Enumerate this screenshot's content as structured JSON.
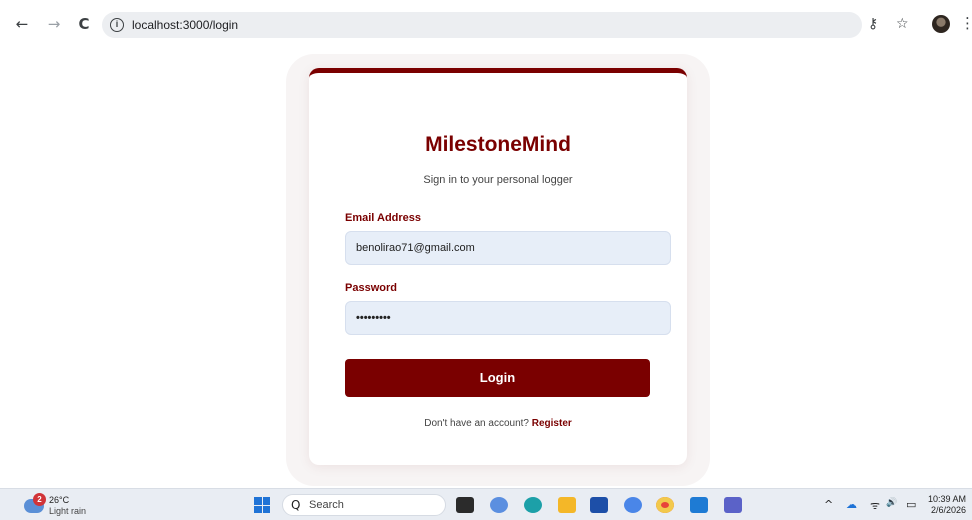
{
  "browser": {
    "url": "localhost:3000/login",
    "back_icon": "←",
    "forward_icon": "→",
    "reload_icon": "C",
    "info_icon": "i",
    "key_icon": "⚷",
    "star_icon": "☆",
    "menu_icon": "⋮"
  },
  "login": {
    "brand": "MilestoneMind",
    "subtitle": "Sign in to your personal logger",
    "email_label": "Email Address",
    "email_value": "benolirao71@gmail.com",
    "password_label": "Password",
    "password_value": "•••••••••",
    "login_button": "Login",
    "footer_prompt": "Don't have an account?",
    "register_link": "Register"
  },
  "taskbar": {
    "weather_badge": "2",
    "temperature": "26°C",
    "weather_desc": "Light rain",
    "search_icon": "Q",
    "search_placeholder": "Search",
    "tray_chevron": "^",
    "wifi_icon": "ᯤ",
    "volume_icon": "🔊",
    "battery_icon": "▭",
    "time": "10:39 AM",
    "date": "2/6/2026"
  },
  "colors": {
    "brand": "#7a0000",
    "field_bg": "#e7eef8"
  }
}
